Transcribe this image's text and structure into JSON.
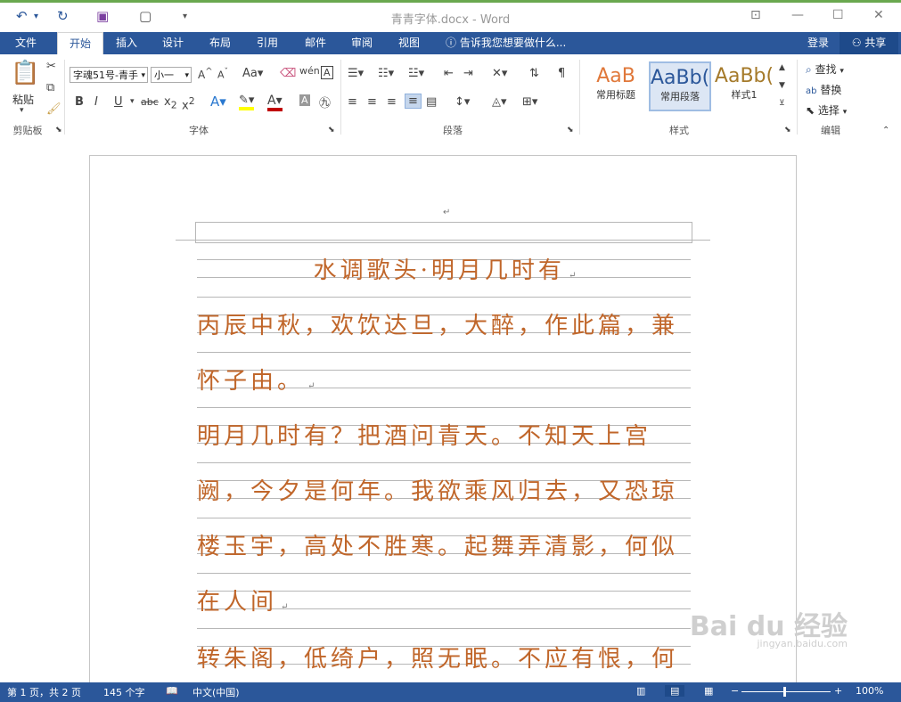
{
  "window": {
    "title": "青青字体.docx - Word"
  },
  "tabs": {
    "file": "文件",
    "home": "开始",
    "insert": "插入",
    "design": "设计",
    "layout": "布局",
    "references": "引用",
    "mailings": "邮件",
    "review": "审阅",
    "view": "视图",
    "tellme": "告诉我您想要做什么...",
    "login": "登录",
    "share": "共享"
  },
  "ribbon": {
    "clipboard": {
      "paste": "粘贴",
      "label": "剪贴板"
    },
    "font": {
      "name": "字魂51号-青手",
      "size": "小一",
      "label": "字体"
    },
    "paragraph": {
      "label": "段落"
    },
    "styles": {
      "label": "样式",
      "items": [
        {
          "preview": "AaB",
          "name": "常用标题"
        },
        {
          "preview": "AaBb(",
          "name": "常用段落"
        },
        {
          "preview": "AaBb(",
          "name": "样式1"
        }
      ]
    },
    "editing": {
      "find": "查找",
      "replace": "替换",
      "select": "选择",
      "label": "编辑"
    }
  },
  "document": {
    "lines": [
      "水调歌头·明月几时有",
      "丙辰中秋，欢饮达旦，大醉，作此篇，兼",
      "怀子由。",
      "明月几时有？把酒问青天。不知天上宫",
      "阙，今夕是何年。我欲乘风归去，又恐琼",
      "楼玉宇，高处不胜寒。起舞弄清影，何似",
      "在人间",
      "转朱阁，低绮户，照无眠。不应有恨，何"
    ]
  },
  "status": {
    "page": "第 1 页，共 2 页",
    "words": "145 个字",
    "language": "中文(中国)",
    "zoom": "100%"
  },
  "watermark": {
    "main": "Bai du 经验",
    "sub": "jingyan.baidu.com"
  }
}
